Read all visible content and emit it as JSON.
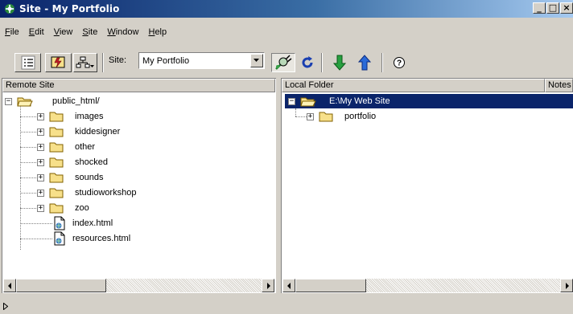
{
  "window": {
    "title": "Site - My Portfolio",
    "controls": [
      "_",
      "□",
      "×"
    ]
  },
  "menu": {
    "items": [
      {
        "label": "File",
        "accel": "F"
      },
      {
        "label": "Edit",
        "accel": "E"
      },
      {
        "label": "View",
        "accel": "V"
      },
      {
        "label": "Site",
        "accel": "S"
      },
      {
        "label": "Window",
        "accel": "W"
      },
      {
        "label": "Help",
        "accel": "H"
      }
    ]
  },
  "toolbar": {
    "site_label": "Site:",
    "site_value": "My Portfolio",
    "buttons": [
      "site-files-view",
      "site-map-view",
      "site-map-options",
      "connect",
      "refresh",
      "get",
      "put",
      "help"
    ]
  },
  "remote": {
    "header": "Remote Site",
    "root": "public_html/",
    "folders": [
      "images",
      "kiddesigner",
      "other",
      "shocked",
      "sounds",
      "studioworkshop",
      "zoo"
    ],
    "files": [
      "index.html",
      "resources.html"
    ]
  },
  "local": {
    "header": "Local Folder",
    "notes_header": "Notes",
    "root": "E:\\My Web Site",
    "folders": [
      "portfolio"
    ]
  },
  "colors": {
    "title_start": "#0a246a",
    "title_end": "#a6caf0",
    "selection": "#0a246a",
    "folder": "#f7e08a",
    "face": "#d4d0c8"
  }
}
